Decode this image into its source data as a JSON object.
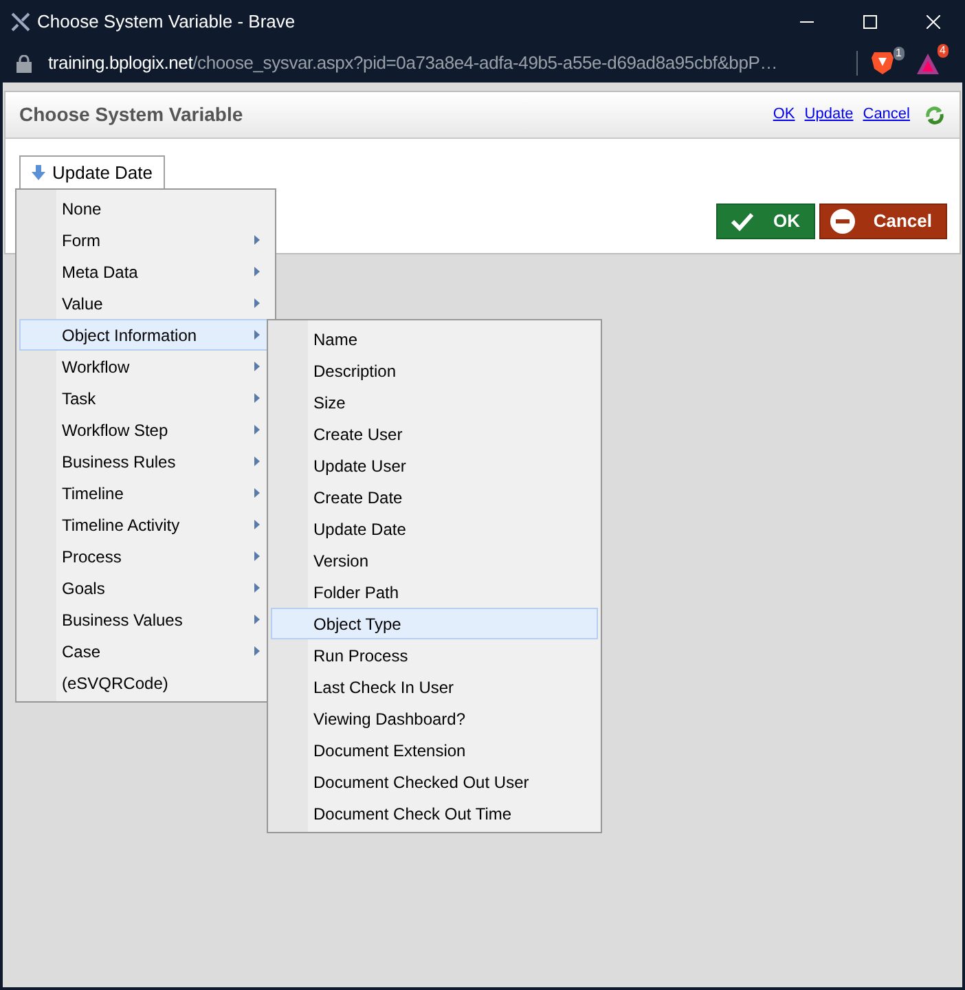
{
  "window": {
    "title": "Choose System Variable - Brave"
  },
  "address_bar": {
    "host": "training.bplogix.net",
    "path": "/choose_sysvar.aspx?pid=0a73a8e4-adfa-49b5-a55e-d69ad8a95cbf&bpP…",
    "shields_badge": "1",
    "rewards_badge": "4"
  },
  "dialog": {
    "title": "Choose System Variable",
    "links": [
      "OK",
      "Update",
      "Cancel"
    ],
    "ok_button": "OK",
    "cancel_button": "Cancel"
  },
  "dropdown": {
    "value": "Update Date",
    "expanded": true
  },
  "menu": [
    {
      "label": "None",
      "has_submenu": false,
      "selected": false
    },
    {
      "label": "Form",
      "has_submenu": true,
      "selected": false
    },
    {
      "label": "Meta Data",
      "has_submenu": true,
      "selected": false
    },
    {
      "label": "Value",
      "has_submenu": true,
      "selected": false
    },
    {
      "label": "Object Information",
      "has_submenu": true,
      "selected": true
    },
    {
      "label": "Workflow",
      "has_submenu": true,
      "selected": false
    },
    {
      "label": "Task",
      "has_submenu": true,
      "selected": false
    },
    {
      "label": "Workflow Step",
      "has_submenu": true,
      "selected": false
    },
    {
      "label": "Business Rules",
      "has_submenu": true,
      "selected": false
    },
    {
      "label": "Timeline",
      "has_submenu": true,
      "selected": false
    },
    {
      "label": "Timeline Activity",
      "has_submenu": true,
      "selected": false
    },
    {
      "label": "Process",
      "has_submenu": true,
      "selected": false
    },
    {
      "label": "Goals",
      "has_submenu": true,
      "selected": false
    },
    {
      "label": "Business Values",
      "has_submenu": true,
      "selected": false
    },
    {
      "label": "Case",
      "has_submenu": true,
      "selected": false
    },
    {
      "label": "(eSVQRCode)",
      "has_submenu": false,
      "selected": false
    }
  ],
  "submenu": [
    {
      "label": "Name",
      "selected": false
    },
    {
      "label": "Description",
      "selected": false
    },
    {
      "label": "Size",
      "selected": false
    },
    {
      "label": "Create User",
      "selected": false
    },
    {
      "label": "Update User",
      "selected": false
    },
    {
      "label": "Create Date",
      "selected": false
    },
    {
      "label": "Update Date",
      "selected": false
    },
    {
      "label": "Version",
      "selected": false
    },
    {
      "label": "Folder Path",
      "selected": false
    },
    {
      "label": "Object Type",
      "selected": true
    },
    {
      "label": "Run Process",
      "selected": false
    },
    {
      "label": "Last Check In User",
      "selected": false
    },
    {
      "label": "Viewing Dashboard?",
      "selected": false
    },
    {
      "label": "Document Extension",
      "selected": false
    },
    {
      "label": "Document Checked Out User",
      "selected": false
    },
    {
      "label": "Document Check Out Time",
      "selected": false
    }
  ]
}
